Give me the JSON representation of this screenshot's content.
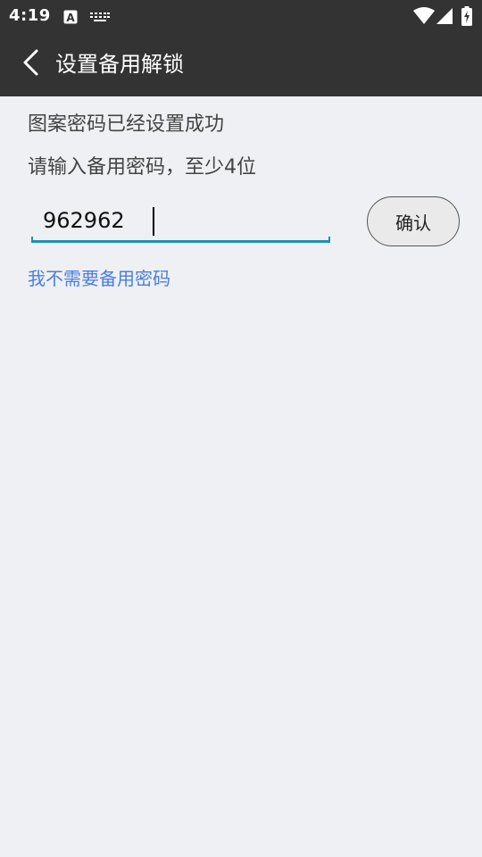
{
  "status_bar": {
    "time": "4:19",
    "icons": [
      "font-a-icon",
      "keyboard-icon",
      "wifi-icon",
      "signal-icon",
      "battery-charging-icon"
    ]
  },
  "app_bar": {
    "title": "设置备用解锁",
    "back_icon": "chevron-left-icon"
  },
  "main": {
    "success_message": "图案密码已经设置成功",
    "prompt": "请输入备用密码，至少4位",
    "password_value": "962962",
    "confirm_label": "确认",
    "skip_link": "我不需要备用密码"
  },
  "colors": {
    "bar_background": "#333333",
    "page_background": "#eff0f3",
    "input_accent": "#1e90b0",
    "link": "#4a7ee0"
  }
}
